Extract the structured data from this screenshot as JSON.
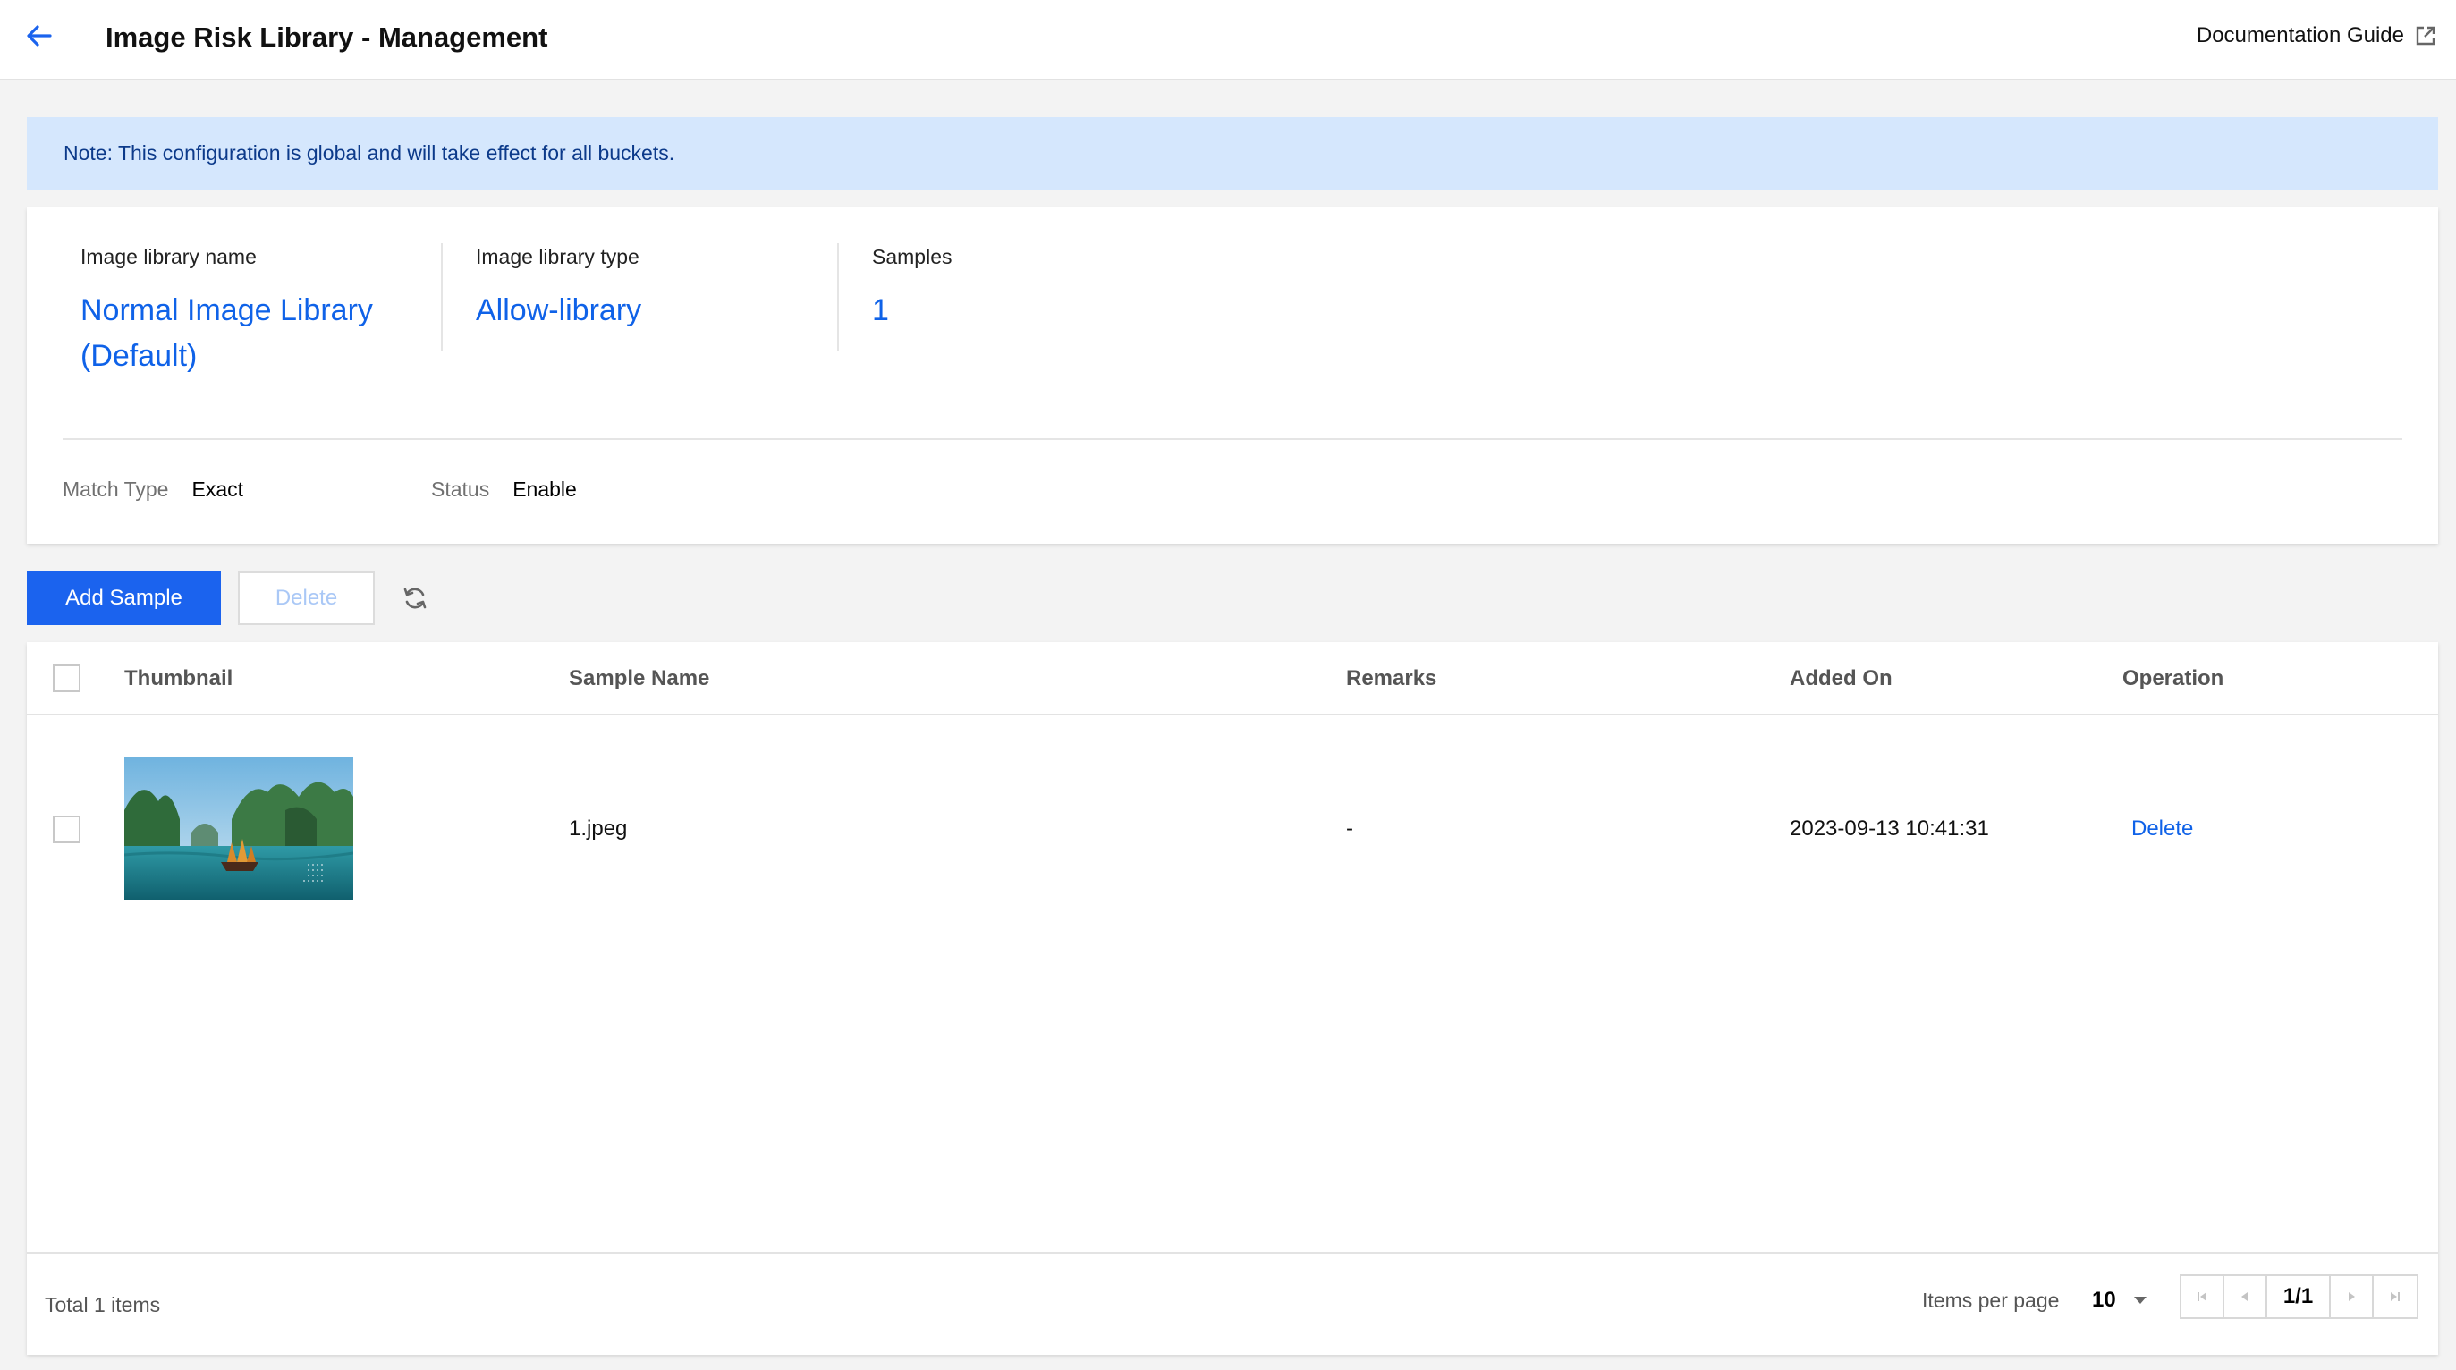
{
  "header": {
    "title": "Image Risk Library - Management",
    "doc_link": "Documentation Guide"
  },
  "note": "Note: This configuration is global and will take effect for all buckets.",
  "library": {
    "name_label": "Image library name",
    "name_value_line1": "Normal Image Library",
    "name_value_line2": "(Default)",
    "type_label": "Image library type",
    "type_value": "Allow-library",
    "samples_label": "Samples",
    "samples_value": "1",
    "match_type_label": "Match Type",
    "match_type_value": "Exact",
    "status_label": "Status",
    "status_value": "Enable"
  },
  "toolbar": {
    "add_label": "Add Sample",
    "delete_label": "Delete"
  },
  "table": {
    "columns": [
      "Thumbnail",
      "Sample Name",
      "Remarks",
      "Added On",
      "Operation"
    ],
    "rows": [
      {
        "sample_name": "1.jpeg",
        "remarks": "-",
        "added_on": "2023-09-13 10:41:31",
        "operation": "Delete"
      }
    ]
  },
  "footer": {
    "total": "Total 1 items",
    "items_per_page_label": "Items per page",
    "items_per_page_value": "10",
    "page_indicator": "1/1"
  },
  "colors": {
    "accent": "#1b63ee",
    "link": "#0f62e8",
    "note_bg": "#d5e7fd"
  }
}
